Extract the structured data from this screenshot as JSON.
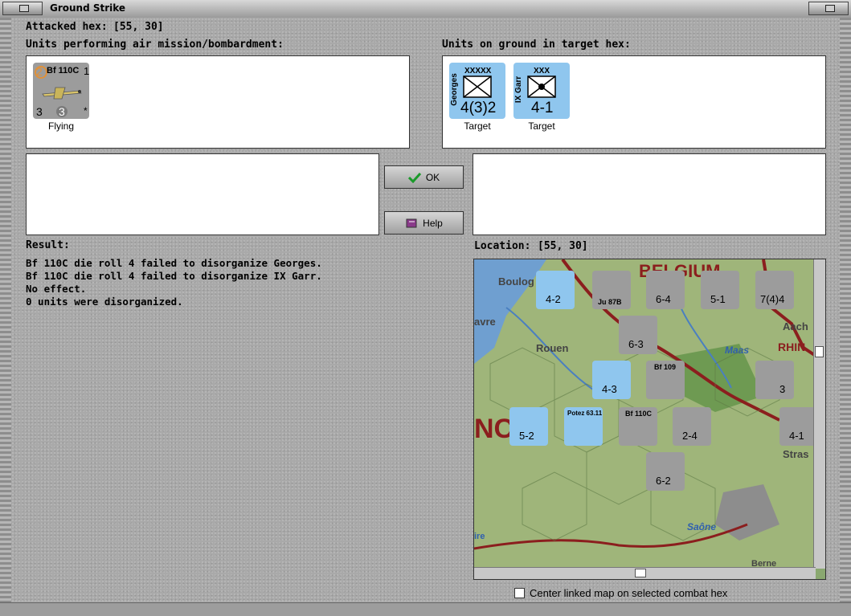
{
  "window": {
    "title": "Ground Strike"
  },
  "attacked_hex": {
    "label": "Attacked hex:",
    "value": "[55, 30]"
  },
  "air_units": {
    "heading": "Units performing air mission/bombardment:",
    "units": [
      {
        "name": "Bf 110C",
        "air_attack": "2",
        "range": "1",
        "left_value": "3",
        "mid_value": "3",
        "mark": "*",
        "status": "Flying"
      }
    ]
  },
  "ground_units": {
    "heading": "Units on ground in target hex:",
    "units": [
      {
        "name": "Georges",
        "size": "XXXXX",
        "strength": "4(3)2",
        "status": "Target"
      },
      {
        "name": "IX Garr",
        "size": "XXX",
        "strength": "4-1",
        "status": "Target"
      }
    ]
  },
  "buttons": {
    "ok": "OK",
    "help": "Help"
  },
  "result": {
    "heading": "Result:",
    "lines": [
      "Bf 110C die roll 4 failed to disorganize Georges.",
      "Bf 110C die roll 4 failed to disorganize IX Garr.",
      "No effect.",
      "0 units were disorganized."
    ]
  },
  "location": {
    "label": "Location:",
    "value": "[55, 30]"
  },
  "map": {
    "places": [
      "Boulog",
      "avre",
      "Rouen",
      "Maas",
      "Aach",
      "RHIN",
      "Stras",
      "Saône",
      "ire",
      "Berne",
      "BELGIUM",
      "NC"
    ],
    "counters": [
      {
        "strength": "4-2"
      },
      {
        "strength": "6-4"
      },
      {
        "strength": "5-1"
      },
      {
        "strength": "7(4)4"
      },
      {
        "strength": "6-3"
      },
      {
        "strength": "4-3"
      },
      {
        "strength": "5-2"
      },
      {
        "strength": "2-4"
      },
      {
        "strength": "4-1"
      },
      {
        "strength": "6-2"
      },
      {
        "strength": "3"
      },
      {
        "strength": "Ju 87B"
      },
      {
        "strength": "Bf 109"
      },
      {
        "strength": "Potez 63.11"
      },
      {
        "strength": "Bf 110C"
      }
    ]
  },
  "linked_map_checkbox": {
    "label": "Center linked map on selected combat hex",
    "checked": false
  },
  "colors": {
    "panel": "#a9a9a9",
    "allied_counter": "#8fc6ee",
    "german_counter": "#9c9c9c"
  }
}
